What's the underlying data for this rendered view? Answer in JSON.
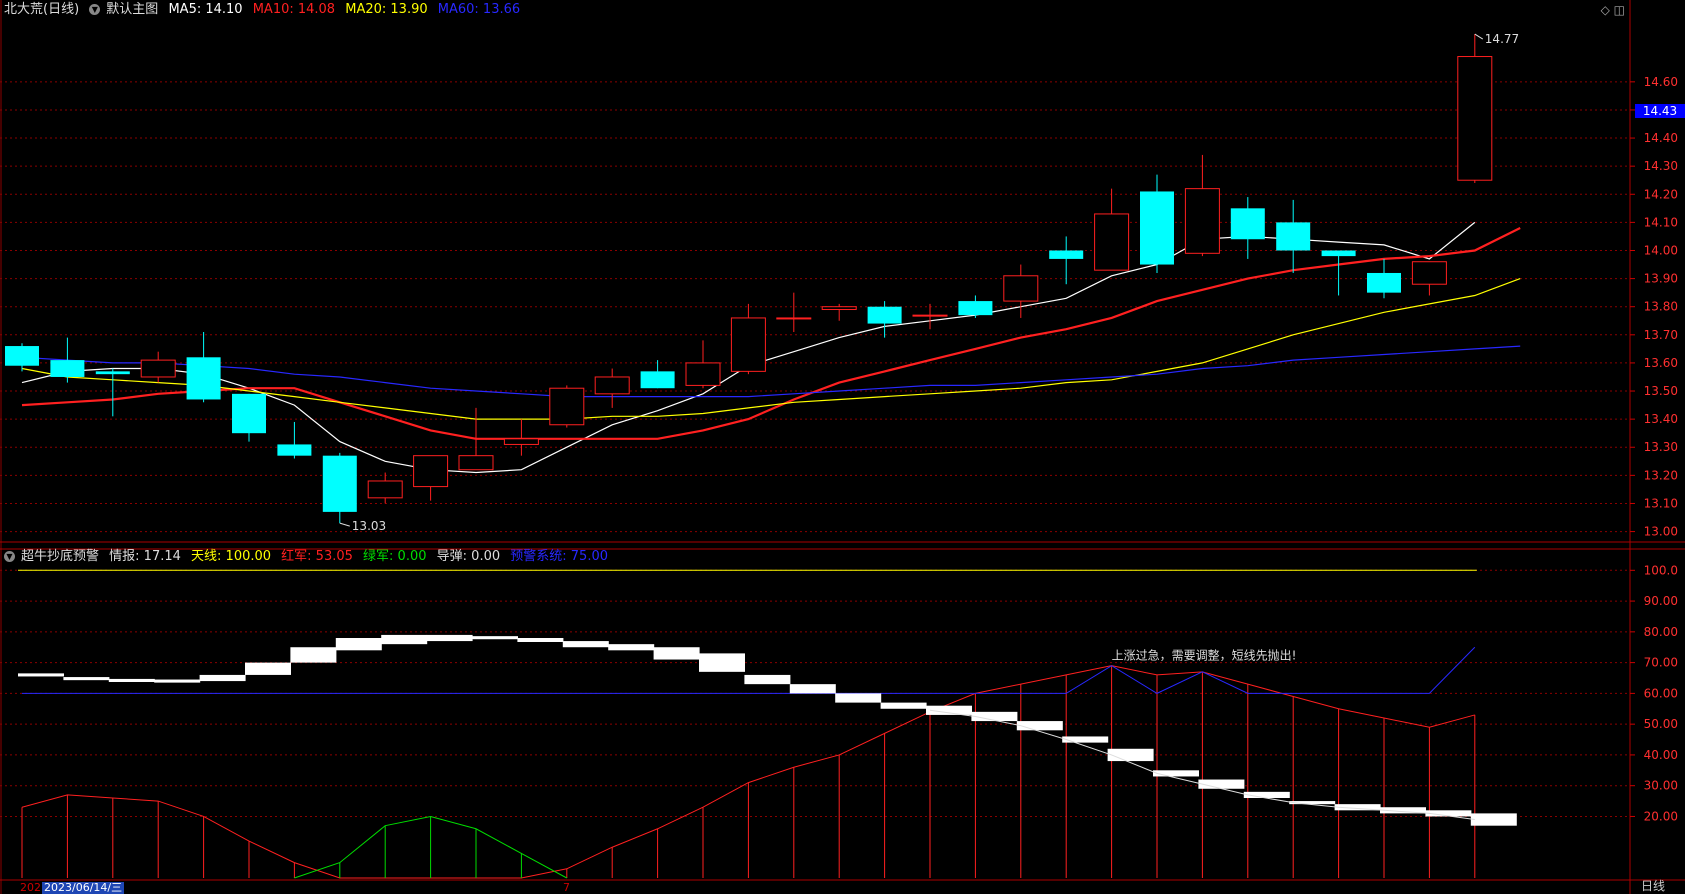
{
  "header": {
    "stock": "北大荒(日线)",
    "template": "默认主图",
    "ma": [
      {
        "label": "MA5: 14.10",
        "color": "#ffffff"
      },
      {
        "label": "MA10: 14.08",
        "color": "#ff2020"
      },
      {
        "label": "MA20: 13.90",
        "color": "#ffff00"
      },
      {
        "label": "MA60: 13.66",
        "color": "#2828ff"
      }
    ]
  },
  "indicator_header": {
    "name": "超牛抄底预警",
    "items": [
      {
        "label": "情报: 17.14",
        "color": "#dddddd"
      },
      {
        "label": "天线: 100.00",
        "color": "#ffff00"
      },
      {
        "label": "红军: 53.05",
        "color": "#ff2020"
      },
      {
        "label": "绿军: 0.00",
        "color": "#00dd00"
      },
      {
        "label": "导弹: 0.00",
        "color": "#dddddd"
      },
      {
        "label": "预警系统: 75.00",
        "color": "#2828ff"
      }
    ]
  },
  "current_price": "14.43",
  "period_label": "日线",
  "date_cursor": "2023/06/14/三",
  "date_stub": "202",
  "date_tick": "7",
  "colors": {
    "up": "#ff2020",
    "down": "#00ffff",
    "ma5": "#ffffff",
    "ma10": "#ff2020",
    "ma20": "#ffff00",
    "ma60": "#2828ff",
    "grid": "#8b0000"
  },
  "chart_data": [
    {
      "type": "candlestick",
      "title": "北大荒(日线)",
      "ylim": [
        12.97,
        14.82
      ],
      "yticks": [
        "14.60",
        "14.50",
        "14.40",
        "14.30",
        "14.20",
        "14.10",
        "14.00",
        "13.90",
        "13.80",
        "13.70",
        "13.60",
        "13.50",
        "13.40",
        "13.30",
        "13.20",
        "13.10",
        "13.00"
      ],
      "high_label": "14.77",
      "low_label": "13.03",
      "candles": [
        {
          "o": 13.66,
          "h": 13.67,
          "l": 13.57,
          "c": 13.59
        },
        {
          "o": 13.61,
          "h": 13.69,
          "l": 13.53,
          "c": 13.55
        },
        {
          "o": 13.57,
          "h": 13.58,
          "l": 13.41,
          "c": 13.56
        },
        {
          "o": 13.55,
          "h": 13.64,
          "l": 13.53,
          "c": 13.61
        },
        {
          "o": 13.62,
          "h": 13.71,
          "l": 13.46,
          "c": 13.47
        },
        {
          "o": 13.49,
          "h": 13.49,
          "l": 13.32,
          "c": 13.35
        },
        {
          "o": 13.31,
          "h": 13.39,
          "l": 13.26,
          "c": 13.27
        },
        {
          "o": 13.27,
          "h": 13.28,
          "l": 13.03,
          "c": 13.07
        },
        {
          "o": 13.12,
          "h": 13.21,
          "l": 13.1,
          "c": 13.18
        },
        {
          "o": 13.16,
          "h": 13.27,
          "l": 13.11,
          "c": 13.27
        },
        {
          "o": 13.22,
          "h": 13.44,
          "l": 13.22,
          "c": 13.27
        },
        {
          "o": 13.31,
          "h": 13.4,
          "l": 13.27,
          "c": 13.33
        },
        {
          "o": 13.38,
          "h": 13.52,
          "l": 13.37,
          "c": 13.51
        },
        {
          "o": 13.49,
          "h": 13.58,
          "l": 13.44,
          "c": 13.55
        },
        {
          "o": 13.57,
          "h": 13.61,
          "l": 13.51,
          "c": 13.51
        },
        {
          "o": 13.52,
          "h": 13.68,
          "l": 13.51,
          "c": 13.6
        },
        {
          "o": 13.57,
          "h": 13.81,
          "l": 13.56,
          "c": 13.76
        },
        {
          "o": 13.76,
          "h": 13.85,
          "l": 13.71,
          "c": 13.76
        },
        {
          "o": 13.79,
          "h": 13.81,
          "l": 13.75,
          "c": 13.8
        },
        {
          "o": 13.8,
          "h": 13.82,
          "l": 13.69,
          "c": 13.74
        },
        {
          "o": 13.77,
          "h": 13.81,
          "l": 13.72,
          "c": 13.77
        },
        {
          "o": 13.82,
          "h": 13.84,
          "l": 13.76,
          "c": 13.77
        },
        {
          "o": 13.82,
          "h": 13.95,
          "l": 13.76,
          "c": 13.91
        },
        {
          "o": 14.0,
          "h": 14.05,
          "l": 13.88,
          "c": 13.97
        },
        {
          "o": 13.93,
          "h": 14.22,
          "l": 13.93,
          "c": 14.13
        },
        {
          "o": 14.21,
          "h": 14.27,
          "l": 13.92,
          "c": 13.95
        },
        {
          "o": 13.99,
          "h": 14.34,
          "l": 13.98,
          "c": 14.22
        },
        {
          "o": 14.15,
          "h": 14.19,
          "l": 13.97,
          "c": 14.04
        },
        {
          "o": 14.1,
          "h": 14.18,
          "l": 13.92,
          "c": 14.0
        },
        {
          "o": 14.0,
          "h": 13.99,
          "l": 13.84,
          "c": 13.98
        },
        {
          "o": 13.92,
          "h": 13.97,
          "l": 13.83,
          "c": 13.85
        },
        {
          "o": 13.88,
          "h": 13.96,
          "l": 13.84,
          "c": 13.96
        },
        {
          "o": 14.25,
          "h": 14.77,
          "l": 14.24,
          "c": 14.69
        }
      ],
      "series": [
        {
          "name": "MA5",
          "values": [
            13.53,
            13.57,
            13.58,
            13.58,
            13.56,
            13.51,
            13.45,
            13.32,
            13.25,
            13.22,
            13.21,
            13.22,
            13.3,
            13.38,
            13.43,
            13.49,
            13.59,
            13.64,
            13.69,
            13.73,
            13.75,
            13.77,
            13.8,
            13.83,
            13.91,
            13.95,
            14.04,
            14.05,
            14.04,
            14.03,
            14.02,
            13.97,
            14.1
          ]
        },
        {
          "name": "MA10",
          "values": [
            13.45,
            13.46,
            13.47,
            13.49,
            13.5,
            13.51,
            13.51,
            13.46,
            13.41,
            13.36,
            13.33,
            13.33,
            13.33,
            13.33,
            13.33,
            13.36,
            13.4,
            13.47,
            13.53,
            13.57,
            13.61,
            13.65,
            13.69,
            13.72,
            13.76,
            13.82,
            13.86,
            13.9,
            13.93,
            13.95,
            13.97,
            13.98,
            14.0,
            14.08
          ]
        },
        {
          "name": "MA20",
          "values": [
            13.58,
            13.55,
            13.54,
            13.53,
            13.52,
            13.5,
            13.48,
            13.46,
            13.44,
            13.42,
            13.4,
            13.4,
            13.4,
            13.41,
            13.41,
            13.42,
            13.44,
            13.46,
            13.47,
            13.48,
            13.49,
            13.5,
            13.51,
            13.53,
            13.54,
            13.57,
            13.6,
            13.65,
            13.7,
            13.74,
            13.78,
            13.81,
            13.84,
            13.9
          ]
        },
        {
          "name": "MA60",
          "values": [
            13.62,
            13.61,
            13.6,
            13.6,
            13.59,
            13.58,
            13.56,
            13.55,
            13.53,
            13.51,
            13.5,
            13.49,
            13.48,
            13.48,
            13.48,
            13.48,
            13.48,
            13.49,
            13.5,
            13.51,
            13.52,
            13.52,
            13.53,
            13.54,
            13.55,
            13.56,
            13.58,
            13.59,
            13.61,
            13.62,
            13.63,
            13.64,
            13.65,
            13.66
          ]
        }
      ]
    },
    {
      "type": "indicator",
      "title": "超牛抄底预警",
      "ylim": [
        0,
        104
      ],
      "yticks": [
        "100.0",
        "90.00",
        "80.00",
        "70.00",
        "60.00",
        "50.00",
        "40.00",
        "30.00",
        "20.00"
      ],
      "annotation": "上涨过急，需要调整，短线先抛出!",
      "tianxian": 100,
      "warning": [
        60,
        60,
        60,
        60,
        60,
        60,
        60,
        60,
        60,
        60,
        60,
        60,
        60,
        60,
        60,
        60,
        60,
        60,
        60,
        60,
        60,
        60,
        60,
        60,
        69,
        60,
        67,
        60,
        60,
        60,
        60,
        60,
        75
      ],
      "red": [
        23,
        27,
        26,
        25,
        20,
        12,
        5,
        0,
        0,
        0,
        0,
        0,
        3,
        10,
        16,
        23,
        31,
        36,
        40,
        47,
        54,
        60,
        63,
        66,
        69,
        66,
        67,
        63,
        59,
        55,
        52,
        49,
        53
      ],
      "green": [
        0,
        0,
        0,
        0,
        0,
        0,
        0,
        5,
        17,
        20,
        16,
        8,
        0,
        0,
        0,
        0,
        0,
        0,
        0,
        0,
        0,
        0,
        0,
        0,
        0,
        0,
        0,
        0,
        0,
        0,
        0,
        0,
        0
      ],
      "info_bars": [
        {
          "o": 65.5,
          "c": 66.5
        },
        {
          "o": 65.3,
          "c": 64.3
        },
        {
          "o": 64.7,
          "c": 63.7
        },
        {
          "o": 64.5,
          "c": 63.5
        },
        {
          "o": 64.0,
          "c": 66.0
        },
        {
          "o": 66.0,
          "c": 70.0
        },
        {
          "o": 70.0,
          "c": 75.0
        },
        {
          "o": 74.0,
          "c": 78.0
        },
        {
          "o": 76.0,
          "c": 79.0
        },
        {
          "o": 77.0,
          "c": 79.0
        },
        {
          "o": 77.6,
          "c": 78.6
        },
        {
          "o": 76.7,
          "c": 78.0
        },
        {
          "o": 75.0,
          "c": 77.0
        },
        {
          "o": 74.0,
          "c": 76.0
        },
        {
          "o": 71.0,
          "c": 75.0
        },
        {
          "o": 67.0,
          "c": 73.0
        },
        {
          "o": 63.0,
          "c": 66.0
        },
        {
          "o": 60.0,
          "c": 63.0
        },
        {
          "o": 57.0,
          "c": 60.0
        },
        {
          "o": 55.0,
          "c": 57.0
        },
        {
          "o": 53.0,
          "c": 56.0
        },
        {
          "o": 51.0,
          "c": 54.0
        },
        {
          "o": 48.0,
          "c": 51.0
        },
        {
          "o": 44.0,
          "c": 46.0
        },
        {
          "o": 38.0,
          "c": 42.0
        },
        {
          "o": 33.0,
          "c": 35.0
        },
        {
          "o": 29.0,
          "c": 32.0
        },
        {
          "o": 26.0,
          "c": 28.0
        },
        {
          "o": 24.0,
          "c": 25.0
        },
        {
          "o": 22.0,
          "c": 24.0
        },
        {
          "o": 21.0,
          "c": 23.0
        },
        {
          "o": 20.0,
          "c": 22.0
        },
        {
          "o": 17.0,
          "c": 21.0
        }
      ]
    }
  ]
}
